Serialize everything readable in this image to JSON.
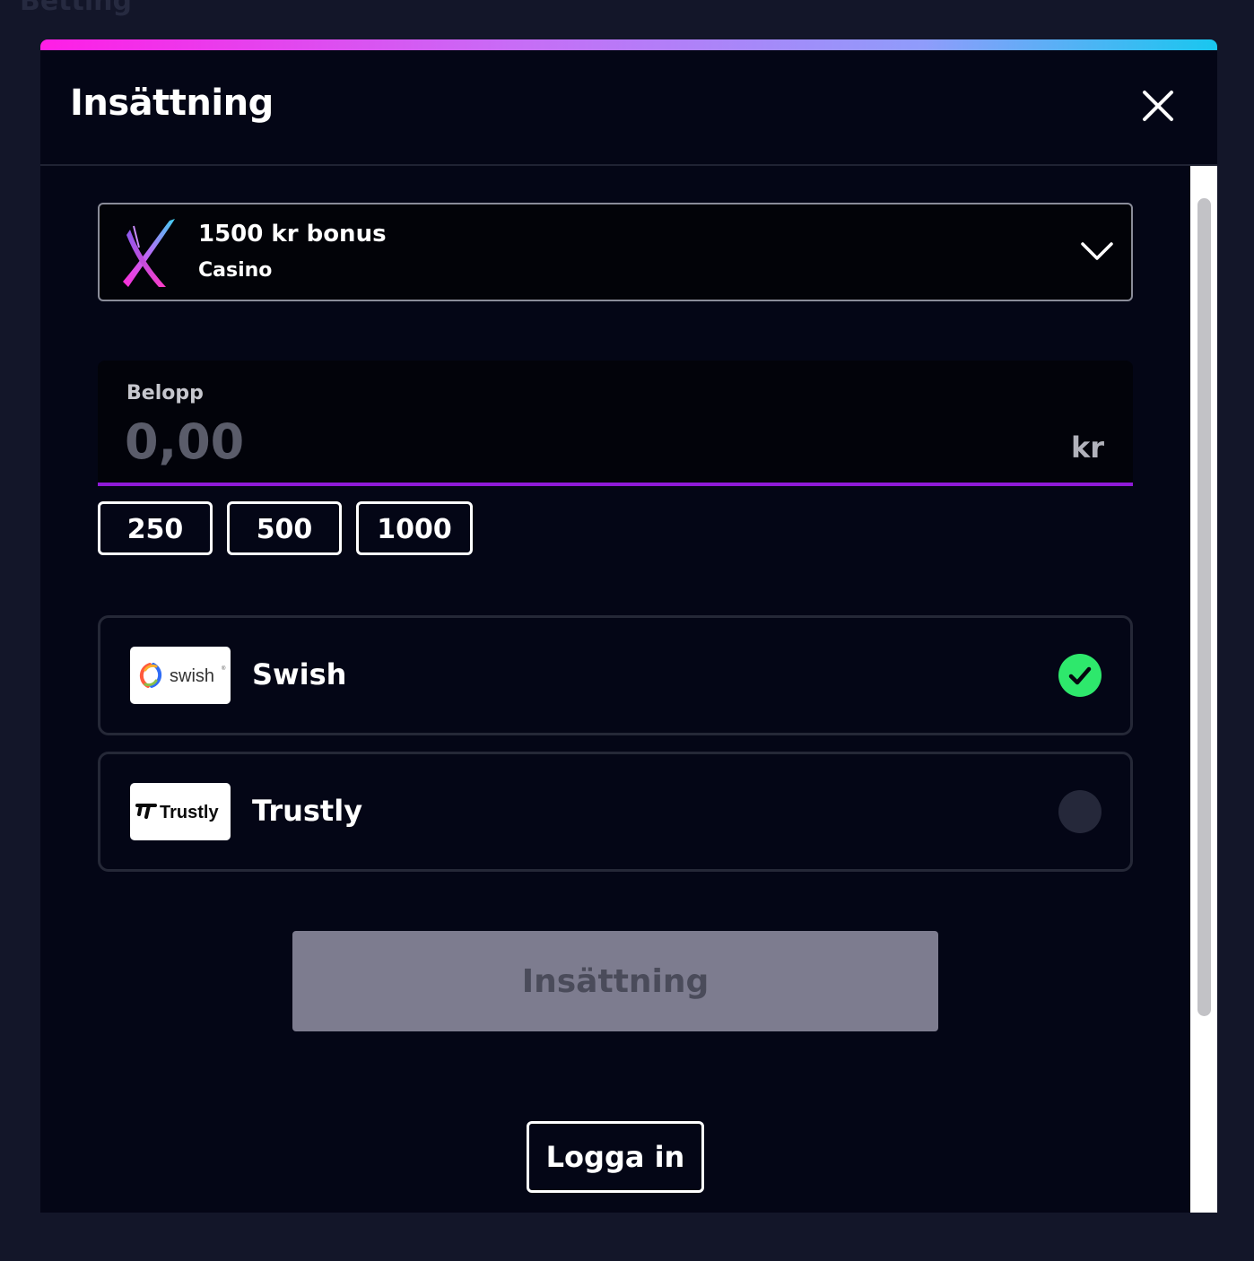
{
  "background": {
    "page_title": "Betting"
  },
  "modal": {
    "title": "Insättning",
    "close_icon": "close-icon",
    "accent_colors": [
      "#ff1ee6",
      "#c86cf6",
      "#8f9cfb",
      "#19c7ef"
    ]
  },
  "bonus": {
    "title": "1500 kr bonus",
    "subtitle": "Casino",
    "logo_icon": "brand-x-logo",
    "expand_icon": "chevron-down-icon"
  },
  "amount": {
    "label": "Belopp",
    "placeholder": "0,00",
    "unit": "kr",
    "underline_color": "#8f1ad8"
  },
  "quick_amounts": [
    "250",
    "500",
    "1000"
  ],
  "payment_methods": [
    {
      "name": "Swish",
      "logo_text": "swish",
      "selected": true,
      "check_color": "#2ee86c"
    },
    {
      "name": "Trustly",
      "logo_text": "Trustly",
      "selected": false
    }
  ],
  "buttons": {
    "submit": "Insättning",
    "login": "Logga in"
  }
}
